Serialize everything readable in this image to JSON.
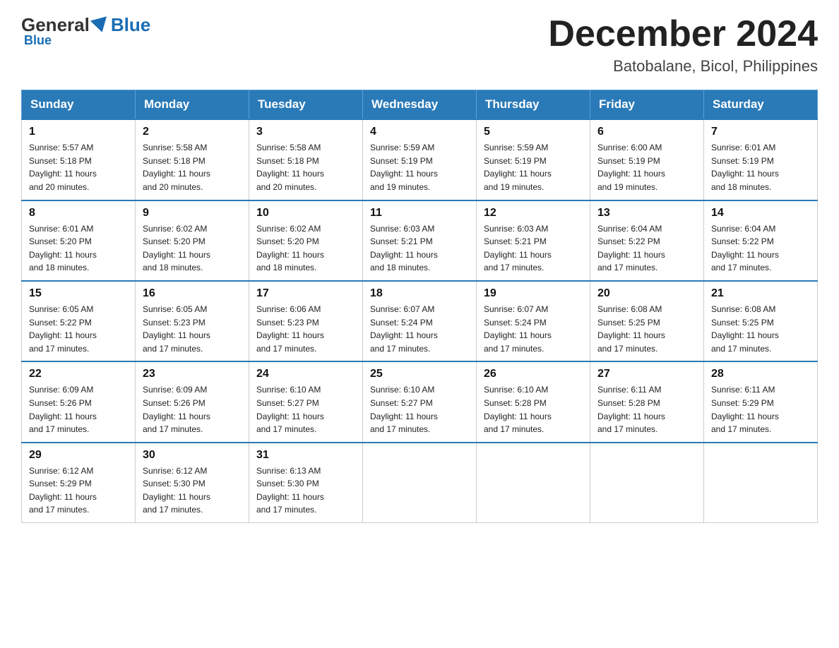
{
  "header": {
    "logo_general": "General",
    "logo_blue": "Blue",
    "month_year": "December 2024",
    "location": "Batobalane, Bicol, Philippines"
  },
  "days_of_week": [
    "Sunday",
    "Monday",
    "Tuesday",
    "Wednesday",
    "Thursday",
    "Friday",
    "Saturday"
  ],
  "weeks": [
    [
      {
        "day": "1",
        "info": "Sunrise: 5:57 AM\nSunset: 5:18 PM\nDaylight: 11 hours\nand 20 minutes."
      },
      {
        "day": "2",
        "info": "Sunrise: 5:58 AM\nSunset: 5:18 PM\nDaylight: 11 hours\nand 20 minutes."
      },
      {
        "day": "3",
        "info": "Sunrise: 5:58 AM\nSunset: 5:18 PM\nDaylight: 11 hours\nand 20 minutes."
      },
      {
        "day": "4",
        "info": "Sunrise: 5:59 AM\nSunset: 5:19 PM\nDaylight: 11 hours\nand 19 minutes."
      },
      {
        "day": "5",
        "info": "Sunrise: 5:59 AM\nSunset: 5:19 PM\nDaylight: 11 hours\nand 19 minutes."
      },
      {
        "day": "6",
        "info": "Sunrise: 6:00 AM\nSunset: 5:19 PM\nDaylight: 11 hours\nand 19 minutes."
      },
      {
        "day": "7",
        "info": "Sunrise: 6:01 AM\nSunset: 5:19 PM\nDaylight: 11 hours\nand 18 minutes."
      }
    ],
    [
      {
        "day": "8",
        "info": "Sunrise: 6:01 AM\nSunset: 5:20 PM\nDaylight: 11 hours\nand 18 minutes."
      },
      {
        "day": "9",
        "info": "Sunrise: 6:02 AM\nSunset: 5:20 PM\nDaylight: 11 hours\nand 18 minutes."
      },
      {
        "day": "10",
        "info": "Sunrise: 6:02 AM\nSunset: 5:20 PM\nDaylight: 11 hours\nand 18 minutes."
      },
      {
        "day": "11",
        "info": "Sunrise: 6:03 AM\nSunset: 5:21 PM\nDaylight: 11 hours\nand 18 minutes."
      },
      {
        "day": "12",
        "info": "Sunrise: 6:03 AM\nSunset: 5:21 PM\nDaylight: 11 hours\nand 17 minutes."
      },
      {
        "day": "13",
        "info": "Sunrise: 6:04 AM\nSunset: 5:22 PM\nDaylight: 11 hours\nand 17 minutes."
      },
      {
        "day": "14",
        "info": "Sunrise: 6:04 AM\nSunset: 5:22 PM\nDaylight: 11 hours\nand 17 minutes."
      }
    ],
    [
      {
        "day": "15",
        "info": "Sunrise: 6:05 AM\nSunset: 5:22 PM\nDaylight: 11 hours\nand 17 minutes."
      },
      {
        "day": "16",
        "info": "Sunrise: 6:05 AM\nSunset: 5:23 PM\nDaylight: 11 hours\nand 17 minutes."
      },
      {
        "day": "17",
        "info": "Sunrise: 6:06 AM\nSunset: 5:23 PM\nDaylight: 11 hours\nand 17 minutes."
      },
      {
        "day": "18",
        "info": "Sunrise: 6:07 AM\nSunset: 5:24 PM\nDaylight: 11 hours\nand 17 minutes."
      },
      {
        "day": "19",
        "info": "Sunrise: 6:07 AM\nSunset: 5:24 PM\nDaylight: 11 hours\nand 17 minutes."
      },
      {
        "day": "20",
        "info": "Sunrise: 6:08 AM\nSunset: 5:25 PM\nDaylight: 11 hours\nand 17 minutes."
      },
      {
        "day": "21",
        "info": "Sunrise: 6:08 AM\nSunset: 5:25 PM\nDaylight: 11 hours\nand 17 minutes."
      }
    ],
    [
      {
        "day": "22",
        "info": "Sunrise: 6:09 AM\nSunset: 5:26 PM\nDaylight: 11 hours\nand 17 minutes."
      },
      {
        "day": "23",
        "info": "Sunrise: 6:09 AM\nSunset: 5:26 PM\nDaylight: 11 hours\nand 17 minutes."
      },
      {
        "day": "24",
        "info": "Sunrise: 6:10 AM\nSunset: 5:27 PM\nDaylight: 11 hours\nand 17 minutes."
      },
      {
        "day": "25",
        "info": "Sunrise: 6:10 AM\nSunset: 5:27 PM\nDaylight: 11 hours\nand 17 minutes."
      },
      {
        "day": "26",
        "info": "Sunrise: 6:10 AM\nSunset: 5:28 PM\nDaylight: 11 hours\nand 17 minutes."
      },
      {
        "day": "27",
        "info": "Sunrise: 6:11 AM\nSunset: 5:28 PM\nDaylight: 11 hours\nand 17 minutes."
      },
      {
        "day": "28",
        "info": "Sunrise: 6:11 AM\nSunset: 5:29 PM\nDaylight: 11 hours\nand 17 minutes."
      }
    ],
    [
      {
        "day": "29",
        "info": "Sunrise: 6:12 AM\nSunset: 5:29 PM\nDaylight: 11 hours\nand 17 minutes."
      },
      {
        "day": "30",
        "info": "Sunrise: 6:12 AM\nSunset: 5:30 PM\nDaylight: 11 hours\nand 17 minutes."
      },
      {
        "day": "31",
        "info": "Sunrise: 6:13 AM\nSunset: 5:30 PM\nDaylight: 11 hours\nand 17 minutes."
      },
      null,
      null,
      null,
      null
    ]
  ]
}
